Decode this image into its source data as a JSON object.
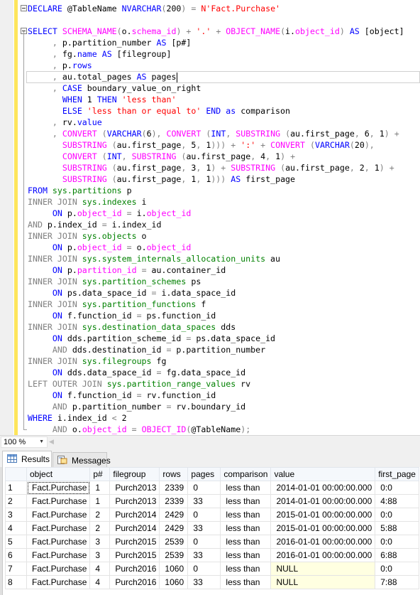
{
  "editor": {
    "lines": [
      [
        [
          "k",
          "DECLARE"
        ],
        [
          "t",
          " @TableName "
        ],
        [
          "k",
          "NVARCHAR"
        ],
        [
          "o",
          "("
        ],
        [
          "t",
          "200"
        ],
        [
          "o",
          ")"
        ],
        [
          "t",
          " "
        ],
        [
          "o",
          "="
        ],
        [
          "t",
          " "
        ],
        [
          "s",
          "N'Fact.Purchase'"
        ]
      ],
      [],
      [
        [
          "k",
          "SELECT"
        ],
        [
          "t",
          " "
        ],
        [
          "f",
          "SCHEMA_NAME"
        ],
        [
          "o",
          "("
        ],
        [
          "t",
          "o."
        ],
        [
          "f",
          "schema_id"
        ],
        [
          "o",
          ")"
        ],
        [
          "t",
          " "
        ],
        [
          "o",
          "+"
        ],
        [
          "t",
          " "
        ],
        [
          "s",
          "'.'"
        ],
        [
          "t",
          " "
        ],
        [
          "o",
          "+"
        ],
        [
          "t",
          " "
        ],
        [
          "f",
          "OBJECT_NAME"
        ],
        [
          "o",
          "("
        ],
        [
          "t",
          "i."
        ],
        [
          "f",
          "object_id"
        ],
        [
          "o",
          ")"
        ],
        [
          "t",
          " "
        ],
        [
          "k",
          "AS"
        ],
        [
          "t",
          " [object]"
        ]
      ],
      [
        [
          "t",
          "     "
        ],
        [
          "o",
          ","
        ],
        [
          "t",
          " p.partition_number "
        ],
        [
          "k",
          "AS"
        ],
        [
          "t",
          " [p#]"
        ]
      ],
      [
        [
          "t",
          "     "
        ],
        [
          "o",
          ","
        ],
        [
          "t",
          " fg."
        ],
        [
          "k",
          "name"
        ],
        [
          "t",
          " "
        ],
        [
          "k",
          "AS"
        ],
        [
          "t",
          " [filegroup]"
        ]
      ],
      [
        [
          "t",
          "     "
        ],
        [
          "o",
          ","
        ],
        [
          "t",
          " p."
        ],
        [
          "k",
          "rows"
        ]
      ],
      [
        [
          "t",
          "     "
        ],
        [
          "o",
          ","
        ],
        [
          "t",
          " au.total_pages "
        ],
        [
          "k",
          "AS"
        ],
        [
          "t",
          " pages"
        ]
      ],
      [
        [
          "t",
          "     "
        ],
        [
          "o",
          ","
        ],
        [
          "t",
          " "
        ],
        [
          "k",
          "CASE"
        ],
        [
          "t",
          " boundary_value_on_right"
        ]
      ],
      [
        [
          "t",
          "       "
        ],
        [
          "k",
          "WHEN"
        ],
        [
          "t",
          " 1 "
        ],
        [
          "k",
          "THEN"
        ],
        [
          "t",
          " "
        ],
        [
          "s",
          "'less than'"
        ]
      ],
      [
        [
          "t",
          "       "
        ],
        [
          "k",
          "ELSE"
        ],
        [
          "t",
          " "
        ],
        [
          "s",
          "'less than or equal to'"
        ],
        [
          "t",
          " "
        ],
        [
          "k",
          "END"
        ],
        [
          "t",
          " "
        ],
        [
          "k",
          "as"
        ],
        [
          "t",
          " comparison"
        ]
      ],
      [
        [
          "t",
          "     "
        ],
        [
          "o",
          ","
        ],
        [
          "t",
          " rv."
        ],
        [
          "k",
          "value"
        ]
      ],
      [
        [
          "t",
          "     "
        ],
        [
          "o",
          ","
        ],
        [
          "t",
          " "
        ],
        [
          "f",
          "CONVERT"
        ],
        [
          "t",
          " "
        ],
        [
          "o",
          "("
        ],
        [
          "k",
          "VARCHAR"
        ],
        [
          "o",
          "("
        ],
        [
          "t",
          "6"
        ],
        [
          "o",
          "),"
        ],
        [
          "t",
          " "
        ],
        [
          "f",
          "CONVERT"
        ],
        [
          "t",
          " "
        ],
        [
          "o",
          "("
        ],
        [
          "k",
          "INT"
        ],
        [
          "o",
          ","
        ],
        [
          "t",
          " "
        ],
        [
          "f",
          "SUBSTRING"
        ],
        [
          "t",
          " "
        ],
        [
          "o",
          "("
        ],
        [
          "t",
          "au.first_page"
        ],
        [
          "o",
          ","
        ],
        [
          "t",
          " 6"
        ],
        [
          "o",
          ","
        ],
        [
          "t",
          " 1"
        ],
        [
          "o",
          ")"
        ],
        [
          "t",
          " "
        ],
        [
          "o",
          "+"
        ]
      ],
      [
        [
          "t",
          "       "
        ],
        [
          "f",
          "SUBSTRING"
        ],
        [
          "t",
          " "
        ],
        [
          "o",
          "("
        ],
        [
          "t",
          "au.first_page"
        ],
        [
          "o",
          ","
        ],
        [
          "t",
          " 5"
        ],
        [
          "o",
          ","
        ],
        [
          "t",
          " 1"
        ],
        [
          "o",
          ")))"
        ],
        [
          "t",
          " "
        ],
        [
          "o",
          "+"
        ],
        [
          "t",
          " "
        ],
        [
          "s",
          "':'"
        ],
        [
          "t",
          " "
        ],
        [
          "o",
          "+"
        ],
        [
          "t",
          " "
        ],
        [
          "f",
          "CONVERT"
        ],
        [
          "t",
          " "
        ],
        [
          "o",
          "("
        ],
        [
          "k",
          "VARCHAR"
        ],
        [
          "o",
          "("
        ],
        [
          "t",
          "20"
        ],
        [
          "o",
          "),"
        ]
      ],
      [
        [
          "t",
          "       "
        ],
        [
          "f",
          "CONVERT"
        ],
        [
          "t",
          " "
        ],
        [
          "o",
          "("
        ],
        [
          "k",
          "INT"
        ],
        [
          "o",
          ","
        ],
        [
          "t",
          " "
        ],
        [
          "f",
          "SUBSTRING"
        ],
        [
          "t",
          " "
        ],
        [
          "o",
          "("
        ],
        [
          "t",
          "au.first_page"
        ],
        [
          "o",
          ","
        ],
        [
          "t",
          " 4"
        ],
        [
          "o",
          ","
        ],
        [
          "t",
          " 1"
        ],
        [
          "o",
          ")"
        ],
        [
          "t",
          " "
        ],
        [
          "o",
          "+"
        ]
      ],
      [
        [
          "t",
          "       "
        ],
        [
          "f",
          "SUBSTRING"
        ],
        [
          "t",
          " "
        ],
        [
          "o",
          "("
        ],
        [
          "t",
          "au.first_page"
        ],
        [
          "o",
          ","
        ],
        [
          "t",
          " 3"
        ],
        [
          "o",
          ","
        ],
        [
          "t",
          " 1"
        ],
        [
          "o",
          ")"
        ],
        [
          "t",
          " "
        ],
        [
          "o",
          "+"
        ],
        [
          "t",
          " "
        ],
        [
          "f",
          "SUBSTRING"
        ],
        [
          "t",
          " "
        ],
        [
          "o",
          "("
        ],
        [
          "t",
          "au.first_page"
        ],
        [
          "o",
          ","
        ],
        [
          "t",
          " 2"
        ],
        [
          "o",
          ","
        ],
        [
          "t",
          " 1"
        ],
        [
          "o",
          ")"
        ],
        [
          "t",
          " "
        ],
        [
          "o",
          "+"
        ]
      ],
      [
        [
          "t",
          "       "
        ],
        [
          "f",
          "SUBSTRING"
        ],
        [
          "t",
          " "
        ],
        [
          "o",
          "("
        ],
        [
          "t",
          "au.first_page"
        ],
        [
          "o",
          ","
        ],
        [
          "t",
          " 1"
        ],
        [
          "o",
          ","
        ],
        [
          "t",
          " 1"
        ],
        [
          "o",
          ")))"
        ],
        [
          "t",
          " "
        ],
        [
          "k",
          "AS"
        ],
        [
          "t",
          " first_page"
        ]
      ],
      [
        [
          "k",
          "FROM"
        ],
        [
          "t",
          " "
        ],
        [
          "g",
          "sys.partitions"
        ],
        [
          "t",
          " p"
        ]
      ],
      [
        [
          "o",
          "INNER JOIN"
        ],
        [
          "t",
          " "
        ],
        [
          "g",
          "sys.indexes"
        ],
        [
          "t",
          " i"
        ]
      ],
      [
        [
          "t",
          "     "
        ],
        [
          "k",
          "ON"
        ],
        [
          "t",
          " p."
        ],
        [
          "f",
          "object_id"
        ],
        [
          "t",
          " "
        ],
        [
          "o",
          "="
        ],
        [
          "t",
          " i."
        ],
        [
          "f",
          "object_id"
        ]
      ],
      [
        [
          "o",
          "AND"
        ],
        [
          "t",
          " p.index_id "
        ],
        [
          "o",
          "="
        ],
        [
          "t",
          " i.index_id"
        ]
      ],
      [
        [
          "o",
          "INNER JOIN"
        ],
        [
          "t",
          " "
        ],
        [
          "g",
          "sys.objects"
        ],
        [
          "t",
          " o"
        ]
      ],
      [
        [
          "t",
          "     "
        ],
        [
          "k",
          "ON"
        ],
        [
          "t",
          " p."
        ],
        [
          "f",
          "object_id"
        ],
        [
          "t",
          " "
        ],
        [
          "o",
          "="
        ],
        [
          "t",
          " o."
        ],
        [
          "f",
          "object_id"
        ]
      ],
      [
        [
          "o",
          "INNER JOIN"
        ],
        [
          "t",
          " "
        ],
        [
          "g",
          "sys.system_internals_allocation_units"
        ],
        [
          "t",
          " au"
        ]
      ],
      [
        [
          "t",
          "     "
        ],
        [
          "k",
          "ON"
        ],
        [
          "t",
          " p."
        ],
        [
          "f",
          "partition_id"
        ],
        [
          "t",
          " "
        ],
        [
          "o",
          "="
        ],
        [
          "t",
          " au.container_id"
        ]
      ],
      [
        [
          "o",
          "INNER JOIN"
        ],
        [
          "t",
          " "
        ],
        [
          "g",
          "sys.partition_schemes"
        ],
        [
          "t",
          " ps"
        ]
      ],
      [
        [
          "t",
          "     "
        ],
        [
          "k",
          "ON"
        ],
        [
          "t",
          " ps.data_space_id "
        ],
        [
          "o",
          "="
        ],
        [
          "t",
          " i.data_space_id"
        ]
      ],
      [
        [
          "o",
          "INNER JOIN"
        ],
        [
          "t",
          " "
        ],
        [
          "g",
          "sys.partition_functions"
        ],
        [
          "t",
          " f"
        ]
      ],
      [
        [
          "t",
          "     "
        ],
        [
          "k",
          "ON"
        ],
        [
          "t",
          " f.function_id "
        ],
        [
          "o",
          "="
        ],
        [
          "t",
          " ps.function_id"
        ]
      ],
      [
        [
          "o",
          "INNER JOIN"
        ],
        [
          "t",
          " "
        ],
        [
          "g",
          "sys.destination_data_spaces"
        ],
        [
          "t",
          " dds"
        ]
      ],
      [
        [
          "t",
          "     "
        ],
        [
          "k",
          "ON"
        ],
        [
          "t",
          " dds.partition_scheme_id "
        ],
        [
          "o",
          "="
        ],
        [
          "t",
          " ps.data_space_id"
        ]
      ],
      [
        [
          "t",
          "     "
        ],
        [
          "o",
          "AND"
        ],
        [
          "t",
          " dds.destination_id "
        ],
        [
          "o",
          "="
        ],
        [
          "t",
          " p.partition_number"
        ]
      ],
      [
        [
          "o",
          "INNER JOIN"
        ],
        [
          "t",
          " "
        ],
        [
          "g",
          "sys.filegroups"
        ],
        [
          "t",
          " fg"
        ]
      ],
      [
        [
          "t",
          "     "
        ],
        [
          "k",
          "ON"
        ],
        [
          "t",
          " dds.data_space_id "
        ],
        [
          "o",
          "="
        ],
        [
          "t",
          " fg.data_space_id"
        ]
      ],
      [
        [
          "o",
          "LEFT OUTER JOIN"
        ],
        [
          "t",
          " "
        ],
        [
          "g",
          "sys.partition_range_values"
        ],
        [
          "t",
          " rv"
        ]
      ],
      [
        [
          "t",
          "     "
        ],
        [
          "k",
          "ON"
        ],
        [
          "t",
          " f.function_id "
        ],
        [
          "o",
          "="
        ],
        [
          "t",
          " rv.function_id"
        ]
      ],
      [
        [
          "t",
          "     "
        ],
        [
          "o",
          "AND"
        ],
        [
          "t",
          " p.partition_number "
        ],
        [
          "o",
          "="
        ],
        [
          "t",
          " rv.boundary_id"
        ]
      ],
      [
        [
          "k",
          "WHERE"
        ],
        [
          "t",
          " i.index_id "
        ],
        [
          "o",
          "<"
        ],
        [
          "t",
          " 2"
        ]
      ],
      [
        [
          "t",
          "     "
        ],
        [
          "o",
          "AND"
        ],
        [
          "t",
          " o."
        ],
        [
          "f",
          "object_id"
        ],
        [
          "t",
          " "
        ],
        [
          "o",
          "="
        ],
        [
          "t",
          " "
        ],
        [
          "f",
          "OBJECT_ID"
        ],
        [
          "o",
          "("
        ],
        [
          "t",
          "@TableName"
        ],
        [
          "o",
          ");"
        ]
      ]
    ]
  },
  "zoom": {
    "value": "100 %"
  },
  "tabs": [
    {
      "label": "Results",
      "icon": "grid-icon",
      "active": true
    },
    {
      "label": "Messages",
      "icon": "messages-icon",
      "active": false
    }
  ],
  "results": {
    "columns": [
      "",
      "object",
      "p#",
      "filegroup",
      "rows",
      "pages",
      "comparison",
      "value",
      "first_page"
    ],
    "rows": [
      [
        "1",
        "Fact.Purchase",
        "1",
        "Purch2013",
        "2339",
        "0",
        "less than",
        "2014-01-01 00:00:00.000",
        "0:0"
      ],
      [
        "2",
        "Fact.Purchase",
        "1",
        "Purch2013",
        "2339",
        "33",
        "less than",
        "2014-01-01 00:00:00.000",
        "4:88"
      ],
      [
        "3",
        "Fact.Purchase",
        "2",
        "Purch2014",
        "2429",
        "0",
        "less than",
        "2015-01-01 00:00:00.000",
        "0:0"
      ],
      [
        "4",
        "Fact.Purchase",
        "2",
        "Purch2014",
        "2429",
        "33",
        "less than",
        "2015-01-01 00:00:00.000",
        "5:88"
      ],
      [
        "5",
        "Fact.Purchase",
        "3",
        "Purch2015",
        "2539",
        "0",
        "less than",
        "2016-01-01 00:00:00.000",
        "0:0"
      ],
      [
        "6",
        "Fact.Purchase",
        "3",
        "Purch2015",
        "2539",
        "33",
        "less than",
        "2016-01-01 00:00:00.000",
        "6:88"
      ],
      [
        "7",
        "Fact.Purchase",
        "4",
        "Purch2016",
        "1060",
        "0",
        "less than",
        "NULL",
        "0:0"
      ],
      [
        "8",
        "Fact.Purchase",
        "4",
        "Purch2016",
        "1060",
        "33",
        "less than",
        "NULL",
        "7:88"
      ]
    ]
  },
  "colors": {
    "keyword": "#0000ff",
    "function": "#ff00ff",
    "string": "#ff0000",
    "operator": "#808080",
    "system_object": "#008000",
    "null_cell": "#ffffe1"
  }
}
